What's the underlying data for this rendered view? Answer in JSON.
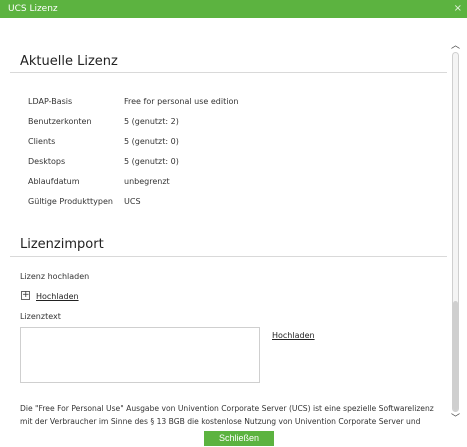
{
  "window": {
    "title": "UCS Lizenz",
    "close_glyph": "×"
  },
  "current_license": {
    "heading": "Aktuelle Lizenz",
    "rows": [
      {
        "label": "LDAP-Basis",
        "value": "Free for personal use edition"
      },
      {
        "label": "Benutzerkonten",
        "value": "5 (genutzt: 2)"
      },
      {
        "label": "Clients",
        "value": "5 (genutzt: 0)"
      },
      {
        "label": "Desktops",
        "value": "5 (genutzt: 0)"
      },
      {
        "label": "Ablaufdatum",
        "value": "unbegrenzt"
      },
      {
        "label": "Gültige Produkttypen",
        "value": "UCS"
      }
    ]
  },
  "license_import": {
    "heading": "Lizenzimport",
    "upload_label": "Lizenz hochladen",
    "upload_link": "Hochladen",
    "text_label": "Lizenztext",
    "text_value": "",
    "text_upload_link": "Hochladen",
    "description": "Die \"Free For Personal Use\" Ausgabe von Univention Corporate Server (UCS) ist eine spezielle Softwarelizenz mit der Verbraucher im Sinne des § 13 BGB die kostenlose Nutzung von Univention Corporate Server und darauf basierenden Softwareprodukten für private Zwecke ermöglicht wird."
  },
  "footer": {
    "close_button": "Schließen"
  },
  "colors": {
    "accent": "#5cb340"
  },
  "icons": {
    "plus": "plus-icon",
    "close": "close-icon",
    "scroll_up": "chevron-up-icon",
    "scroll_down": "chevron-down-icon"
  }
}
